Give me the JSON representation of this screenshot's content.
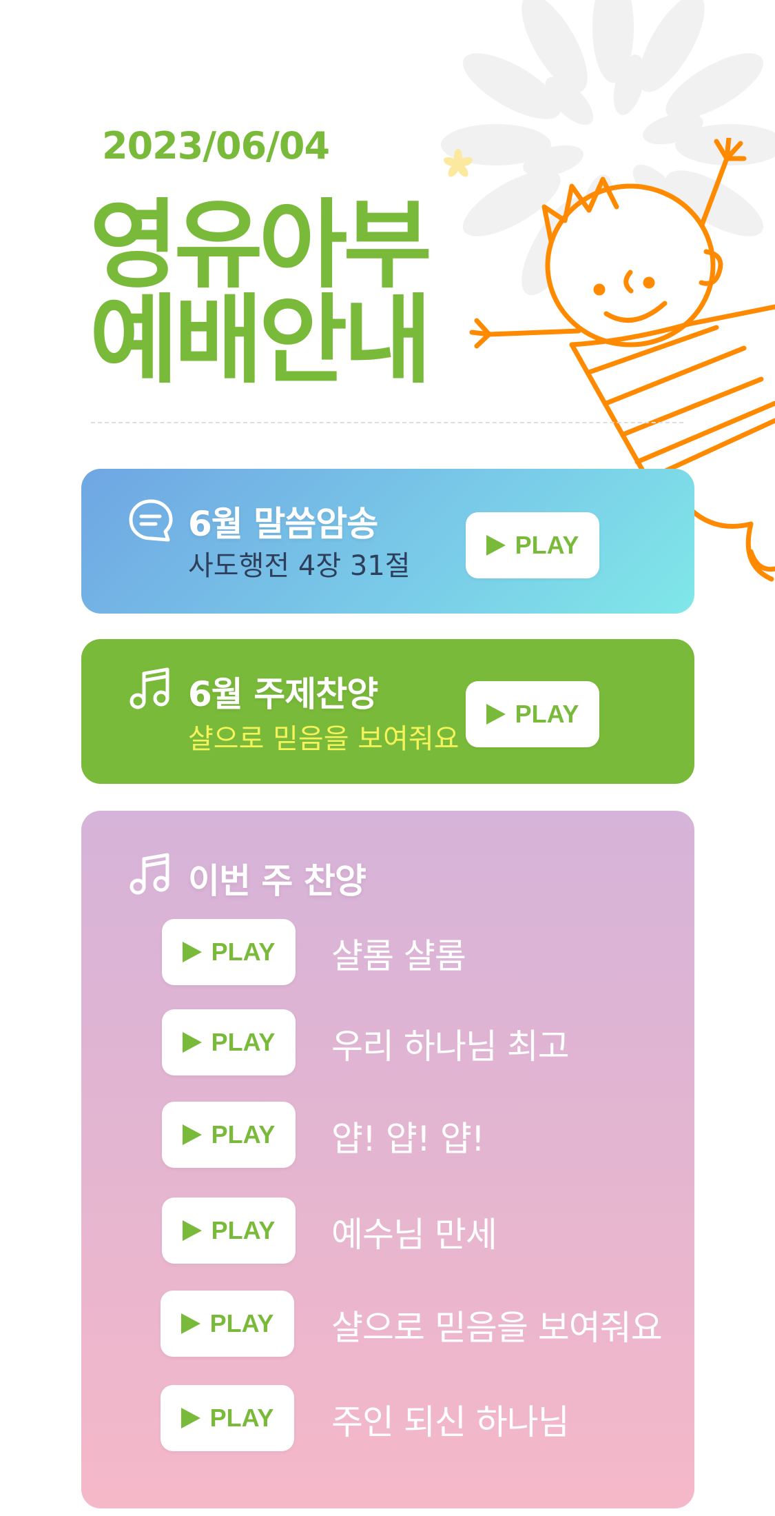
{
  "header": {
    "date": "2023/06/04",
    "title_line1": "영유아부",
    "title_line2": "예배안내"
  },
  "memory_verse": {
    "icon": "chat-icon",
    "title": "6월 말씀암송",
    "subtitle": "사도행전 4장 31절",
    "play_label": "PLAY"
  },
  "theme_song": {
    "icon": "music-note-icon",
    "title": "6월 주제찬양",
    "subtitle": "샬으로 믿음을 보여줘요",
    "play_label": "PLAY"
  },
  "weekly_songs": {
    "icon": "music-note-icon",
    "title": "이번 주 찬양",
    "play_label": "PLAY",
    "items": [
      {
        "name": "샬롬 샬롬"
      },
      {
        "name": "우리 하나님 최고"
      },
      {
        "name": "얍! 얍! 얍!"
      },
      {
        "name": "예수님 만세"
      },
      {
        "name": "샬으로 믿음을 보여줘요"
      },
      {
        "name": "주인 되신 하나님"
      }
    ]
  },
  "colors": {
    "brand_green": "#7aba3a",
    "subtitle_dark": "#2e3f5c",
    "subtitle_yellow": "#f4f45a",
    "illustration_orange": "#ff8a00"
  }
}
